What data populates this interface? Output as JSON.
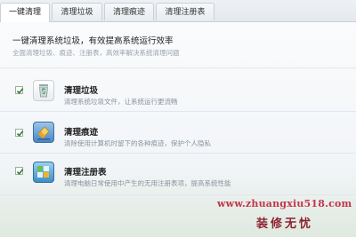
{
  "tabs": [
    {
      "label": "一键清理",
      "active": true
    },
    {
      "label": "清理垃圾",
      "active": false
    },
    {
      "label": "清理痕迹",
      "active": false
    },
    {
      "label": "清理注册表",
      "active": false
    }
  ],
  "header": {
    "title": "一键清理系统垃圾，有效提高系统运行效率",
    "subtitle": "全面清理垃圾、痕迹、注册表，高效率解决系统清理问题"
  },
  "items": [
    {
      "title": "清理垃圾",
      "desc": "清理系统垃圾文件，让系统运行更流畅",
      "checked": true,
      "icon": "recycle-bin-icon"
    },
    {
      "title": "清理痕迹",
      "desc": "清除使用计算机时留下的各种痕迹，保护个人隐私",
      "checked": true,
      "icon": "eraser-icon"
    },
    {
      "title": "清理注册表",
      "desc": "清理电脑日常使用中产生的无用注册表项，提高系统性能",
      "checked": true,
      "icon": "registry-icon"
    }
  ],
  "watermark": {
    "url": "www.zhuangxiu518.com",
    "brand": "装修无忧"
  },
  "colors": {
    "check": "#2e7d32",
    "accent_blue": "#3a7bc8"
  }
}
